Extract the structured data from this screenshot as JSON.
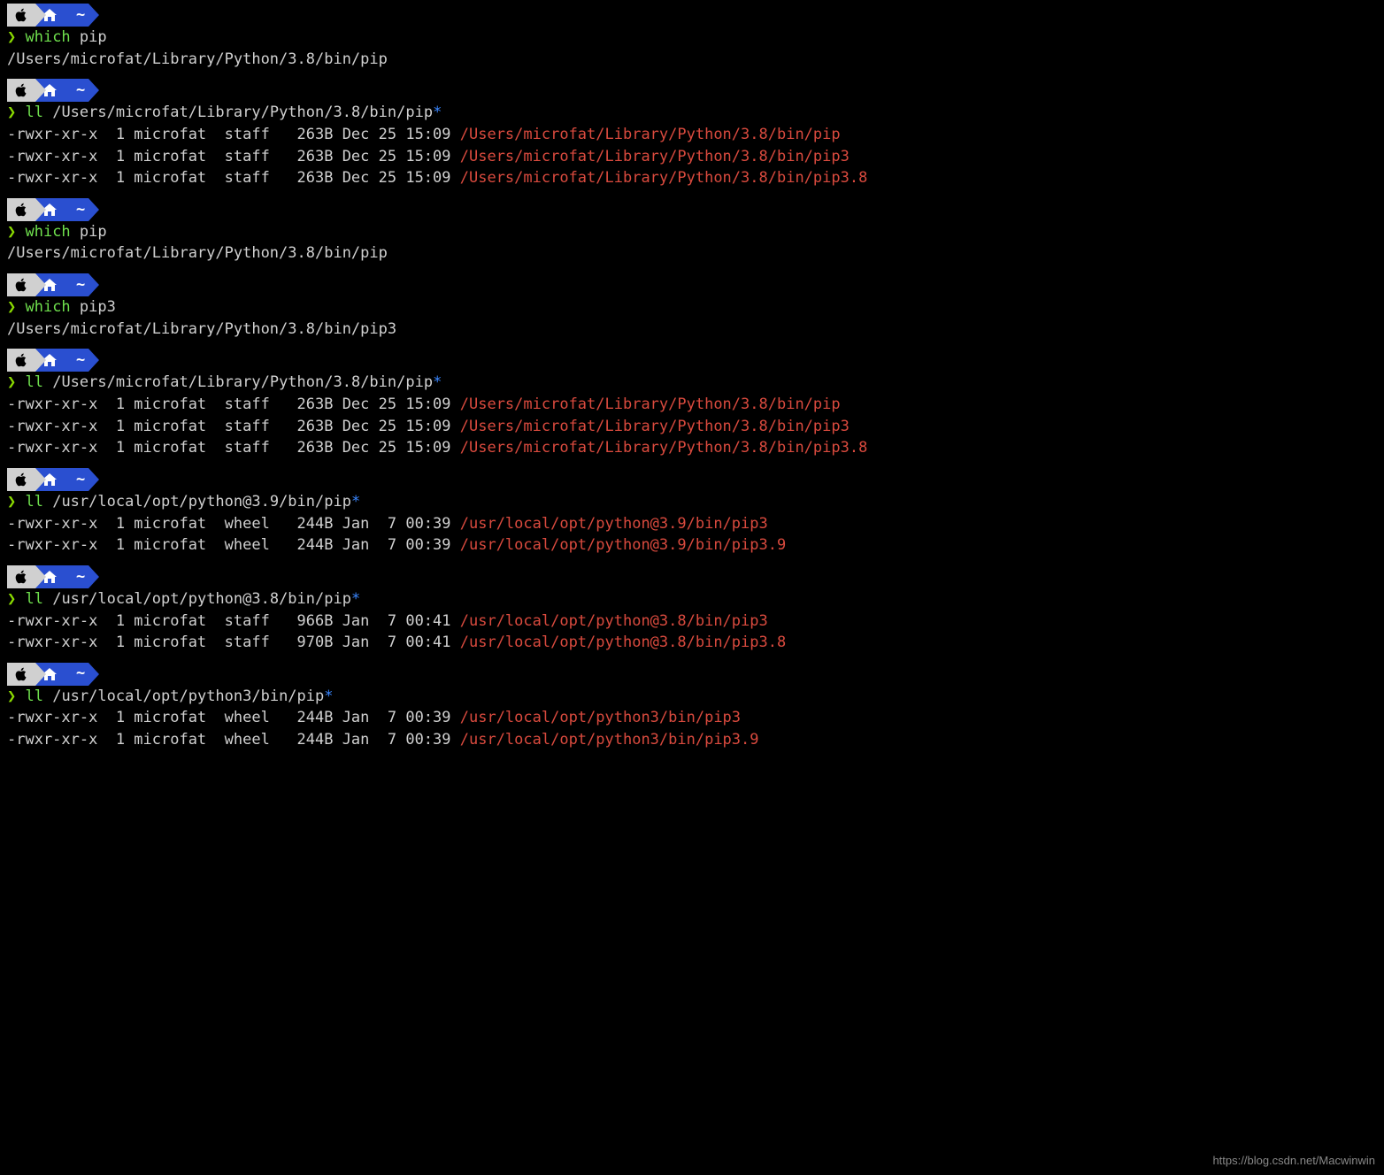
{
  "powerline": {
    "tilde": "~"
  },
  "blocks": [
    {
      "cmd": "which",
      "arg": "pip",
      "star": "",
      "outputs": [
        "/Users/microfat/Library/Python/3.8/bin/pip"
      ],
      "ls": []
    },
    {
      "cmd": "ll",
      "arg": "/Users/microfat/Library/Python/3.8/bin/pip",
      "star": "*",
      "outputs": [],
      "ls": [
        {
          "meta": "-rwxr-xr-x  1 microfat  staff   263B Dec 25 15:09 ",
          "path": "/Users/microfat/Library/Python/3.8/bin/pip"
        },
        {
          "meta": "-rwxr-xr-x  1 microfat  staff   263B Dec 25 15:09 ",
          "path": "/Users/microfat/Library/Python/3.8/bin/pip3"
        },
        {
          "meta": "-rwxr-xr-x  1 microfat  staff   263B Dec 25 15:09 ",
          "path": "/Users/microfat/Library/Python/3.8/bin/pip3.8"
        }
      ]
    },
    {
      "cmd": "which",
      "arg": "pip",
      "star": "",
      "outputs": [
        "/Users/microfat/Library/Python/3.8/bin/pip"
      ],
      "ls": []
    },
    {
      "cmd": "which",
      "arg": "pip3",
      "star": "",
      "outputs": [
        "/Users/microfat/Library/Python/3.8/bin/pip3"
      ],
      "ls": []
    },
    {
      "cmd": "ll",
      "arg": "/Users/microfat/Library/Python/3.8/bin/pip",
      "star": "*",
      "outputs": [],
      "ls": [
        {
          "meta": "-rwxr-xr-x  1 microfat  staff   263B Dec 25 15:09 ",
          "path": "/Users/microfat/Library/Python/3.8/bin/pip"
        },
        {
          "meta": "-rwxr-xr-x  1 microfat  staff   263B Dec 25 15:09 ",
          "path": "/Users/microfat/Library/Python/3.8/bin/pip3"
        },
        {
          "meta": "-rwxr-xr-x  1 microfat  staff   263B Dec 25 15:09 ",
          "path": "/Users/microfat/Library/Python/3.8/bin/pip3.8"
        }
      ]
    },
    {
      "cmd": "ll",
      "arg": "/usr/local/opt/python@3.9/bin/pip",
      "star": "*",
      "outputs": [],
      "ls": [
        {
          "meta": "-rwxr-xr-x  1 microfat  wheel   244B Jan  7 00:39 ",
          "path": "/usr/local/opt/python@3.9/bin/pip3"
        },
        {
          "meta": "-rwxr-xr-x  1 microfat  wheel   244B Jan  7 00:39 ",
          "path": "/usr/local/opt/python@3.9/bin/pip3.9"
        }
      ]
    },
    {
      "cmd": "ll",
      "arg": "/usr/local/opt/python@3.8/bin/pip",
      "star": "*",
      "outputs": [],
      "ls": [
        {
          "meta": "-rwxr-xr-x  1 microfat  staff   966B Jan  7 00:41 ",
          "path": "/usr/local/opt/python@3.8/bin/pip3"
        },
        {
          "meta": "-rwxr-xr-x  1 microfat  staff   970B Jan  7 00:41 ",
          "path": "/usr/local/opt/python@3.8/bin/pip3.8"
        }
      ]
    },
    {
      "cmd": "ll",
      "arg": "/usr/local/opt/python3/bin/pip",
      "star": "*",
      "outputs": [],
      "ls": [
        {
          "meta": "-rwxr-xr-x  1 microfat  wheel   244B Jan  7 00:39 ",
          "path": "/usr/local/opt/python3/bin/pip3"
        },
        {
          "meta": "-rwxr-xr-x  1 microfat  wheel   244B Jan  7 00:39 ",
          "path": "/usr/local/opt/python3/bin/pip3.9"
        }
      ]
    }
  ],
  "watermark": "https://blog.csdn.net/Macwinwin"
}
